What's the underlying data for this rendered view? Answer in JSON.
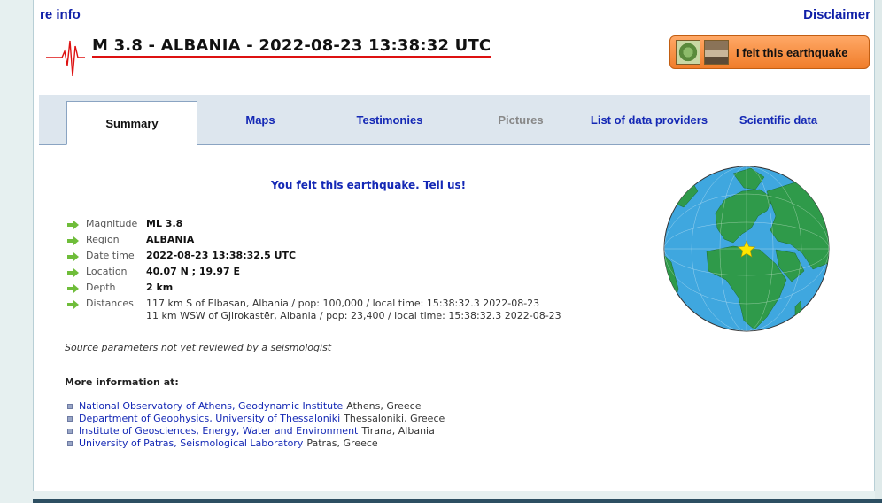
{
  "header": {
    "more_info_link": "re info",
    "disclaimer_link": "Disclaimer",
    "title": "M 3.8 - ALBANIA - 2022-08-23 13:38:32 UTC",
    "felt_button": "I felt this earthquake"
  },
  "tabs": [
    {
      "label": "Summary",
      "state": "active"
    },
    {
      "label": "Maps",
      "state": "normal"
    },
    {
      "label": "Testimonies",
      "state": "normal"
    },
    {
      "label": "Pictures",
      "state": "disabled"
    },
    {
      "label": "List of data providers",
      "state": "normal"
    },
    {
      "label": "Scientific data",
      "state": "normal"
    }
  ],
  "felt_link": "You felt this earthquake. Tell us!",
  "parameters": [
    {
      "label": "Magnitude",
      "value": "ML 3.8"
    },
    {
      "label": "Region",
      "value": "ALBANIA"
    },
    {
      "label": "Date time",
      "value": "2022-08-23 13:38:32.5 UTC"
    },
    {
      "label": "Location",
      "value": "40.07 N ; 19.97 E"
    },
    {
      "label": "Depth",
      "value": "2 km"
    }
  ],
  "distances": {
    "label": "Distances",
    "lines": [
      "117 km S of Elbasan, Albania / pop: 100,000 / local time: 15:38:32.3 2022-08-23",
      "11 km WSW of Gjirokastër, Albania / pop: 23,400 / local time: 15:38:32.3 2022-08-23"
    ]
  },
  "source_note": "Source parameters not yet reviewed by a seismologist",
  "more_info": {
    "heading": "More information at:",
    "links": [
      {
        "name": "National Observatory of Athens, Geodynamic Institute",
        "place": "Athens, Greece"
      },
      {
        "name": "Department of Geophysics, University of Thessaloniki",
        "place": "Thessaloniki, Greece"
      },
      {
        "name": "Institute of Geosciences, Energy, Water and Environment",
        "place": "Tirana, Albania"
      },
      {
        "name": "University of Patras, Seismological Laboratory",
        "place": "Patras, Greece"
      }
    ]
  },
  "colors": {
    "link_blue": "#1428b5",
    "title_red_line": "#dd1111",
    "button_orange": "#f07d2a",
    "ocean": "#3fa7df",
    "land": "#2f9a4a"
  },
  "icons": [
    "seismogram-icon",
    "felt-map-thumbnail",
    "felt-photo-thumbnail",
    "green-arrow-icon",
    "square-bullet-icon",
    "globe-map",
    "epicenter-star-icon"
  ]
}
